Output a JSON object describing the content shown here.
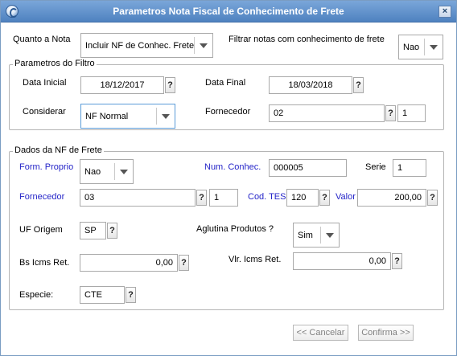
{
  "window": {
    "title": "Parametros Nota Fiscal de Conhecimento de Frete",
    "close_label": "×"
  },
  "top": {
    "quanto_label": "Quanto a Nota",
    "quanto_value": "Incluir NF de Conhec. Frete",
    "filtrar_label": "Filtrar notas com conhecimento de frete",
    "filtrar_value": "Nao"
  },
  "filtro": {
    "legend": "Parametros do Filtro",
    "data_inicial_label": "Data Inicial",
    "data_inicial_value": "18/12/2017",
    "data_final_label": "Data Final",
    "data_final_value": "18/03/2018",
    "considerar_label": "Considerar",
    "considerar_value": "NF Normal",
    "fornecedor_label": "Fornecedor",
    "fornecedor_value": "02",
    "loja_value": "1"
  },
  "frete": {
    "legend": "Dados da NF de Frete",
    "form_proprio_label": "Form. Proprio",
    "form_proprio_value": "Nao",
    "num_conhec_label": "Num. Conhec.",
    "num_conhec_value": "000005",
    "serie_label": "Serie",
    "serie_value": "1",
    "fornecedor_label": "Fornecedor",
    "fornecedor_value": "03",
    "loja_value": "1",
    "cod_tes_label": "Cod. TES",
    "cod_tes_value": "120",
    "valor_label": "Valor",
    "valor_value": "200,00",
    "uf_origem_label": "UF Origem",
    "uf_origem_value": "SP",
    "aglutina_label": "Aglutina Produtos ?",
    "aglutina_value": "Sim",
    "bs_icms_label": "Bs Icms Ret.",
    "bs_icms_value": "0,00",
    "vlr_icms_label": "Vlr. Icms Ret.",
    "vlr_icms_value": "0,00",
    "especie_label": "Especie:",
    "especie_value": "CTE"
  },
  "lookup_label": "?",
  "buttons": {
    "cancelar": "<< Cancelar",
    "confirma": "Confirma >>"
  },
  "colors": {
    "title_bar": "#5a8dc8",
    "required_label": "#2424c8",
    "disabled_button_text": "#808080"
  },
  "icons": {
    "app": "totvs-logo-icon",
    "close": "close-icon",
    "dropdown": "chevron-down-icon"
  }
}
